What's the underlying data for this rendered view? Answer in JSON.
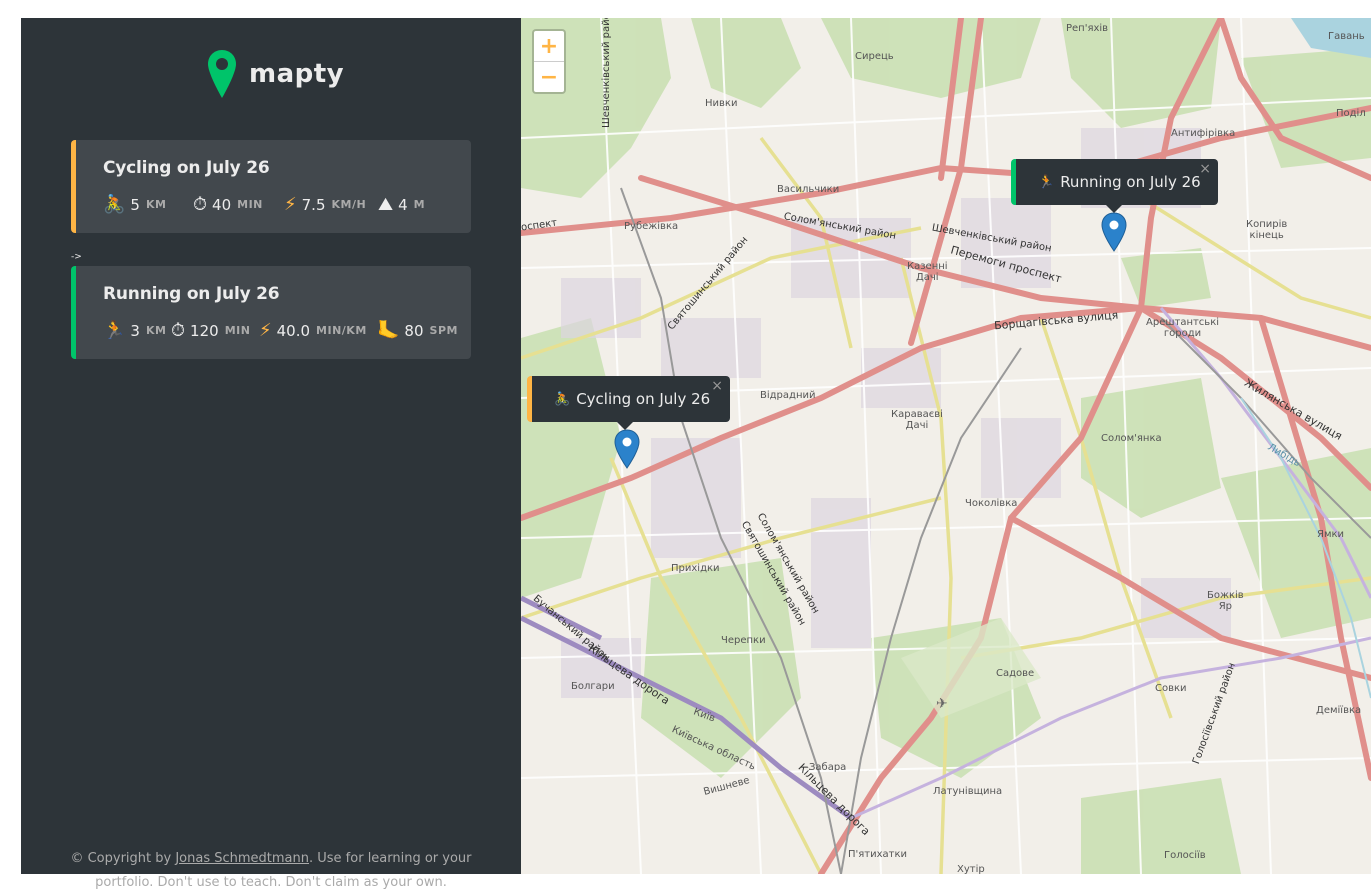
{
  "app": {
    "logo_text": "mapty"
  },
  "workouts": [
    {
      "type": "cycling",
      "title": "Cycling on July 26",
      "icon": "🚴",
      "distance": "5",
      "distance_unit": "KM",
      "duration": "40",
      "duration_unit": "MIN",
      "speed": "7.5",
      "speed_unit": "KM/H",
      "elevation": "4",
      "elevation_unit": "M"
    },
    {
      "type": "running",
      "title": "Running on July 26",
      "icon": "🏃",
      "distance": "3",
      "distance_unit": "KM",
      "duration": "120",
      "duration_unit": "MIN",
      "pace": "40.0",
      "pace_unit": "MIN/KM",
      "cadence": "80",
      "cadence_unit": "SPM"
    }
  ],
  "arrow_text": "->",
  "footer": {
    "prefix": "© Copyright by ",
    "author": "Jonas Schmedtmann",
    "suffix": ". Use for learning or your",
    "line2": "portfolio. Don't use to teach. Don't claim as your own."
  },
  "map": {
    "zoom_in": "+",
    "zoom_out": "−",
    "popups": [
      {
        "type": "running",
        "icon": "🏃",
        "text": "Running on July 26",
        "close": "×"
      },
      {
        "type": "cycling",
        "icon": "🚴",
        "text": "Cycling on July 26",
        "close": "×"
      }
    ],
    "labels": {
      "syrets": "Сирець",
      "reriakhiv": "Реп'яхів",
      "havan": "Гавань",
      "nyvky": "Нивки",
      "antyfirivka": "Антифірівка",
      "podil": "Поділ",
      "vasylchyky": "Васильчики",
      "rubezhivka": "Рубежівка",
      "kazenni": "Казенні\nДачі",
      "kopyriv": "Копирів\nкінець",
      "arestantski": "Арештантські\nгороди",
      "vidradnyi": "Відрадний",
      "karavaievi": "Караваєві\nДачі",
      "solomianka": "Солом'янка",
      "chokolivka": "Чоколівка",
      "prykhidky": "Прихідки",
      "cherepky": "Черепки",
      "bolhary": "Болгари",
      "sadove": "Садове",
      "sovky": "Совки",
      "bozhkiv": "Божків\nЯр",
      "demiivka": "Деміївка",
      "zabara": "Забара",
      "latunivshchyna": "Латунівщина",
      "vyshneve": "Вишневе",
      "piatykhatky": "П'ятихатки",
      "holosiiv": "Голосіїв",
      "khutir": "Хутір",
      "kyiv": "Київ",
      "kyivska": "Київська область",
      "yamky": "Ямки",
      "lybid": "Либідь"
    },
    "roads": {
      "shevchenkivskyi_v": "Шевченківський район",
      "solomianskyi": "Солом'янський район",
      "shevchenkivskyi": "Шевченківський район",
      "peremohy": "Перемоги проспект",
      "borshchahivska": "Борщагівська вулиця",
      "sviatoshynskyi": "Святошинський район",
      "zhylianska": "Жилянська вулиця",
      "solomianskyi2": "Солом'янський район",
      "sviatoshynskyi2": "Святошинський район",
      "buchanskyi": "Бучанський район",
      "kiltseva": "Кільцева дорога",
      "kiltseva2": "Кільцева дорога",
      "holosiivskyi": "Голосіївський район",
      "prospekt": "оспект"
    }
  }
}
